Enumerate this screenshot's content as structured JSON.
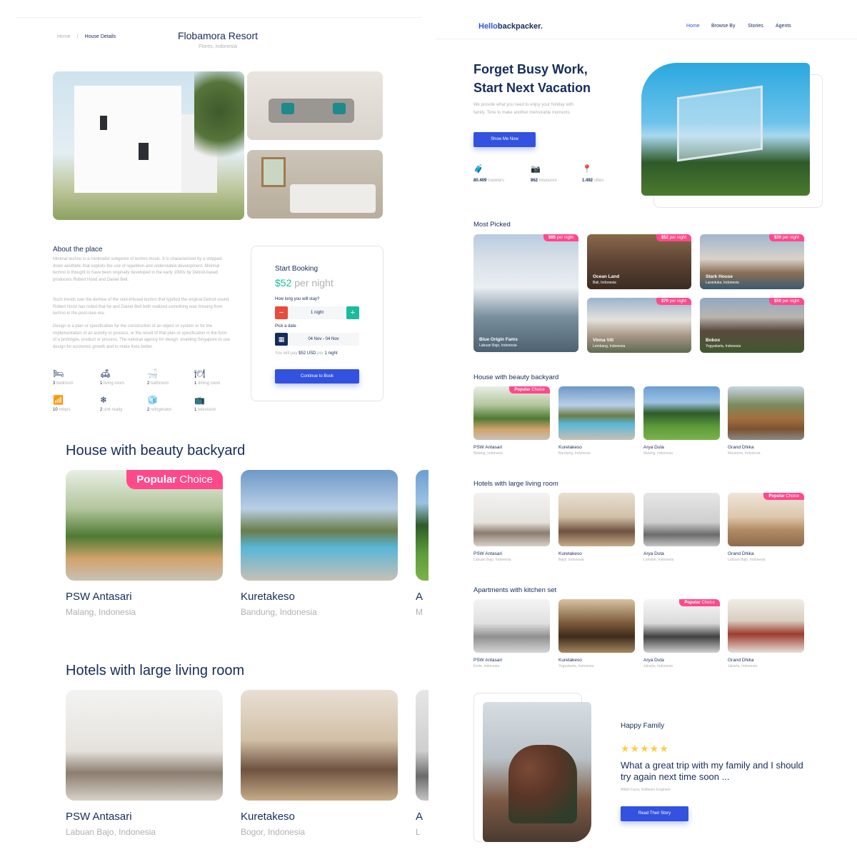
{
  "detail": {
    "breadcrumb": {
      "home": "Home",
      "separator": "/",
      "current": "House Details"
    },
    "title": "Flobamora Resort",
    "subtitle": "Flores, Indonesia",
    "about": {
      "heading": "About the place",
      "paragraphs": [
        "Minimal techno is a minimalist subgenre of techno music. It is characterized by a stripped-down aesthetic that exploits the use of repetition and understated development. Minimal techno is thought to have been originally developed in the early 1990s by Detroit-based producers Robert Hood and Daniel Bell.",
        "Such trends saw the demise of the soul-infused techno that typified the original Detroit sound. Robert Hood has noted that he and Daniel Bell both realized something was missing from techno in the post-rave era.",
        "Design is a plan or specification for the construction of an object or system or for the implementation of an activity or process, or the result of that plan or specification in the form of a prototype, product or process. The national agency for design: enabling Singapore to use design for economic growth and to make lives better."
      ]
    },
    "features": [
      {
        "icon": "bedroom-icon",
        "glyph": "🛏",
        "count": "3",
        "label": "bedroom"
      },
      {
        "icon": "living-room-icon",
        "glyph": "🛋",
        "count": "1",
        "label": "living room"
      },
      {
        "icon": "bathroom-icon",
        "glyph": "🛁",
        "count": "2",
        "label": "bathroom"
      },
      {
        "icon": "dining-room-icon",
        "glyph": "🍽",
        "count": "1",
        "label": "dining room"
      },
      {
        "icon": "wifi-icon",
        "glyph": "📶",
        "count": "10",
        "label": "mbp/s"
      },
      {
        "icon": "ac-unit-icon",
        "glyph": "❄",
        "count": "2",
        "label": "unit ready"
      },
      {
        "icon": "refrigerator-icon",
        "glyph": "🧊",
        "count": "2",
        "label": "refrigerator"
      },
      {
        "icon": "television-icon",
        "glyph": "📺",
        "count": "1",
        "label": "television"
      }
    ],
    "booking": {
      "heading": "Start Booking",
      "price": "$52",
      "per": "per night",
      "stay_question": "How long you will stay?",
      "minus": "−",
      "plus": "+",
      "nights": "1 night",
      "pick_date": "Pick a date",
      "date_range": "04 Nov - 04 Nov",
      "pay_prefix": "You will pay",
      "pay_amount": "$52 USD",
      "pay_mid": "per",
      "pay_nights": "1 night",
      "cta": "Continue to Book"
    },
    "sections": [
      {
        "heading": "House with beauty backyard",
        "items": [
          {
            "name": "PSW Antasari",
            "location": "Malang, Indonesia",
            "popular": true
          },
          {
            "name": "Kuretakeso",
            "location": "Bandung, Indonesia",
            "popular": false
          },
          {
            "name": "A",
            "location": "M",
            "popular": false
          }
        ]
      },
      {
        "heading": "Hotels with large living room",
        "items": [
          {
            "name": "PSW Antasari",
            "location": "Labuan Bajo, Indonesia",
            "popular": false
          },
          {
            "name": "Kuretakeso",
            "location": "Bogor, Indonesia",
            "popular": false
          },
          {
            "name": "A",
            "location": "L",
            "popular": false
          }
        ]
      }
    ],
    "popular_badge": {
      "bold": "Popular",
      "rest": " Choice"
    }
  },
  "landing": {
    "logo": {
      "part1": "Hello",
      "part2": "backpacker."
    },
    "nav": [
      "Home",
      "Browse By",
      "Stories",
      "Agents"
    ],
    "hero": {
      "line1": "Forget Busy Work,",
      "line2": "Start Next Vacation",
      "text": "We provide what you need to enjoy your holiday with family. Time to make another memorable moments.",
      "cta": "Show Me Now"
    },
    "stats": [
      {
        "icon": "traveler-icon",
        "glyph": "🧳",
        "value": "80.409",
        "label": "travelers"
      },
      {
        "icon": "camera-icon",
        "glyph": "📷",
        "value": "862",
        "label": "treasures"
      },
      {
        "icon": "location-pin-icon",
        "glyph": "📍",
        "value": "1.492",
        "label": "cities"
      }
    ],
    "most_picked": {
      "heading": "Most Picked",
      "items": [
        {
          "price": "$85",
          "per": " per night",
          "name": "Blue Origin Fams",
          "location": "Labuan Bajo, Indonesia"
        },
        {
          "price": "$52",
          "per": " per night",
          "name": "Ocean Land",
          "location": "Bali, Indonesia"
        },
        {
          "price": "$30",
          "per": " per night",
          "name": "Stark House",
          "location": "Larantuka, Indonesia"
        },
        {
          "price": "$70",
          "per": " per night",
          "name": "Vinna Vill",
          "location": "Lembang, Indonesia"
        },
        {
          "price": "$50",
          "per": " per night",
          "name": "Bobox",
          "location": "Yogyakarta, Indonesia"
        }
      ]
    },
    "categories": [
      {
        "heading": "House with beauty backyard",
        "items": [
          {
            "name": "PSW Antasari",
            "location": "Malang, Indonesia",
            "popular": true
          },
          {
            "name": "Kuretakeso",
            "location": "Bandung, Indonesia",
            "popular": false
          },
          {
            "name": "Arya Duta",
            "location": "Malang, Indonesia",
            "popular": false
          },
          {
            "name": "Grand Dhika",
            "location": "Maumere, Indonesia",
            "popular": false
          }
        ]
      },
      {
        "heading": "Hotels with large living room",
        "items": [
          {
            "name": "PSW Antasari",
            "location": "Labuan Bajo, Indonesia",
            "popular": false
          },
          {
            "name": "Kuretakeso",
            "location": "Bajol, Indonesia",
            "popular": false
          },
          {
            "name": "Arya Duta",
            "location": "Lombok, Indonesia",
            "popular": false
          },
          {
            "name": "Grand Dhika",
            "location": "Labuan Bajo, Indonesia",
            "popular": true
          }
        ]
      },
      {
        "heading": "Apartments with kitchen set",
        "items": [
          {
            "name": "PSW Antasari",
            "location": "Ende, Indonesia",
            "popular": false
          },
          {
            "name": "Kuretakeso",
            "location": "Yogyakarta, Indonesia",
            "popular": false
          },
          {
            "name": "Arya Duta",
            "location": "Jakarta, Indonesia",
            "popular": true
          },
          {
            "name": "Grand Dhika",
            "location": "Jakarta, Indonesia",
            "popular": false
          }
        ]
      }
    ],
    "testimonial": {
      "heading": "Happy Family",
      "stars": "★★★★★",
      "quote": "What a great trip with my family and I should try again next time soon ...",
      "author": "Afifah Farra, Software Engineer",
      "cta": "Read Their Story"
    },
    "colors": {
      "primary": "#3252df",
      "navy": "#152c5b",
      "pink": "#ff498b",
      "teal": "#1abc9c",
      "red": "#e74c3c",
      "star": "#ffcc47",
      "muted": "#b0b0b0"
    }
  }
}
